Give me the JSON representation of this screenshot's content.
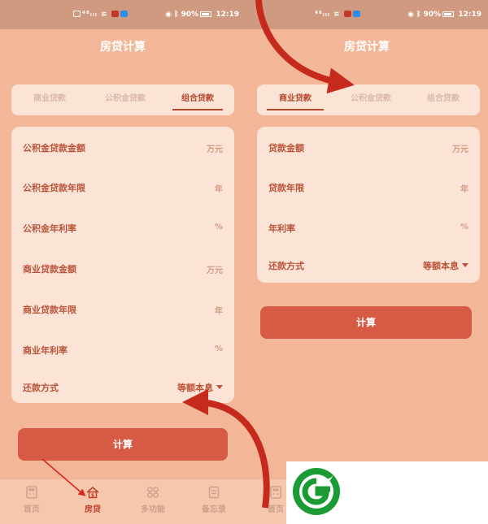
{
  "status_bar": {
    "network": "⁴⁶ᵢₗₗ",
    "battery": "90%",
    "time": "12:19"
  },
  "app_title": "房贷计算",
  "left_screen": {
    "tabs": [
      "商业贷款",
      "公积金贷款",
      "组合贷款"
    ],
    "active_tab": 2,
    "rows": [
      {
        "label": "公积金贷款金额",
        "unit": "万元"
      },
      {
        "label": "公积金贷款年限",
        "unit": "年"
      },
      {
        "label": "公积金年利率",
        "unit": "%"
      },
      {
        "label": "商业贷款金额",
        "unit": "万元"
      },
      {
        "label": "商业贷款年限",
        "unit": "年"
      },
      {
        "label": "商业年利率",
        "unit": "%"
      }
    ],
    "repayment": {
      "label": "还款方式",
      "value": "等额本息"
    },
    "calc_button": "计算"
  },
  "right_screen": {
    "tabs": [
      "商业贷款",
      "公积金贷款",
      "组合贷款"
    ],
    "active_tab": 0,
    "rows": [
      {
        "label": "贷款金额",
        "unit": "万元"
      },
      {
        "label": "贷款年限",
        "unit": "年"
      },
      {
        "label": "年利率",
        "unit": "%"
      }
    ],
    "repayment": {
      "label": "还款方式",
      "value": "等额本息"
    },
    "calc_button": "计算"
  },
  "bottom_nav": {
    "items": [
      "首页",
      "房贷",
      "多功能",
      "备忘录"
    ],
    "active": 1,
    "right_partial_label": "首页"
  },
  "colors": {
    "background": "#f3b698",
    "card": "#fbe3d5",
    "accent": "#d75a45",
    "text": "#b9543a",
    "annotation_arrow": "#c62a1c",
    "logo_green": "#1a9b34"
  },
  "icons": [
    "calculator-icon",
    "house-icon",
    "grid-icon",
    "notes-icon",
    "wifi-icon",
    "bluetooth-icon",
    "eye-icon",
    "battery-icon"
  ]
}
